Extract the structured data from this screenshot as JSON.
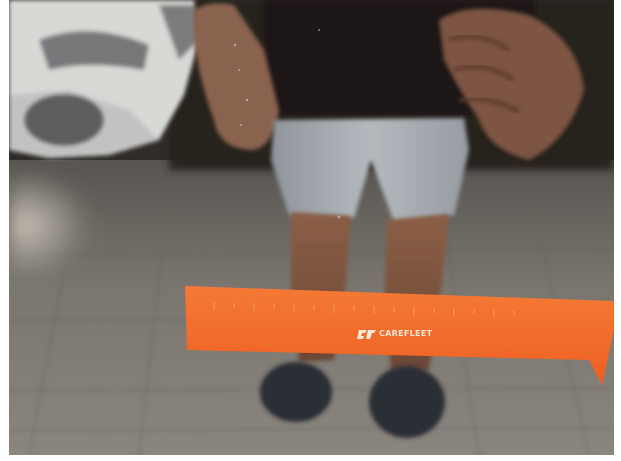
{
  "photo": {
    "subject": "",
    "ruler": {
      "brand_text": "CAREFLEET",
      "subtitle_text": "",
      "color": "#f26a2a"
    },
    "colors": {
      "floor": "#6e6a64",
      "paint_reflection": "#2c2a28",
      "shorts": "#a9aeb4",
      "skin": "#8a5e45",
      "car": "#d9d9d6"
    }
  }
}
